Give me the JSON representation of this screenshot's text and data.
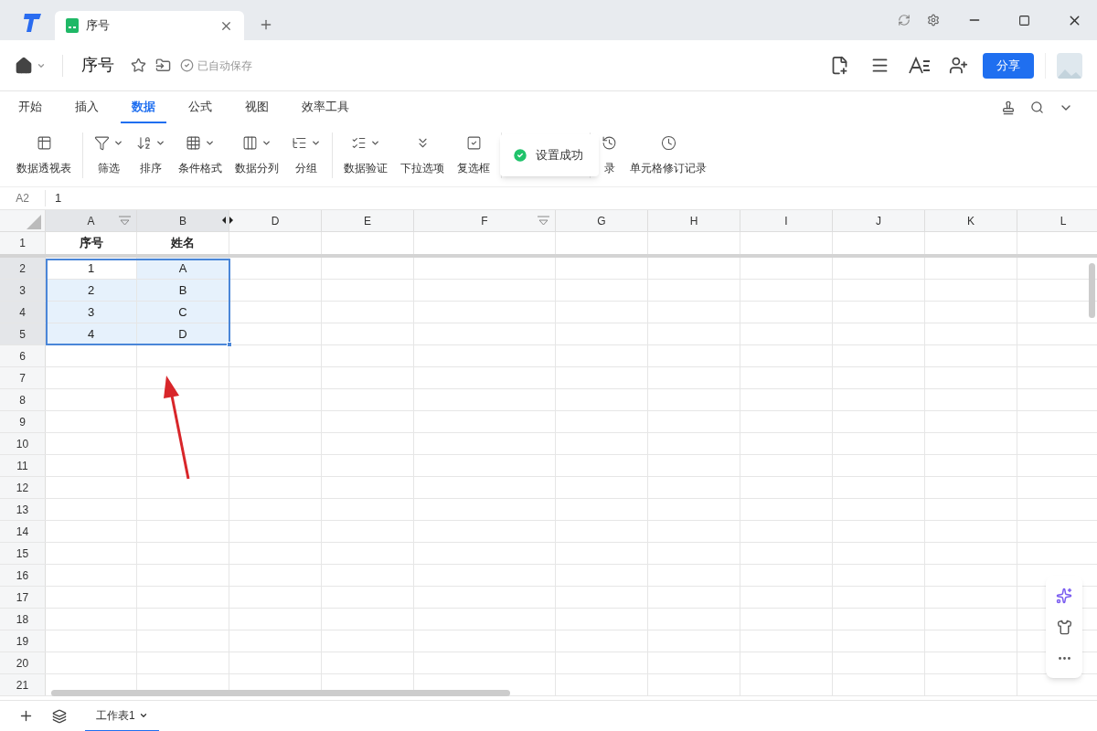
{
  "window": {
    "tab_title": "序号"
  },
  "header": {
    "doc_title": "序号",
    "save_status": "已自动保存",
    "share": "分享"
  },
  "ribbon_tabs": [
    {
      "label": "开始",
      "selected": false
    },
    {
      "label": "插入",
      "selected": false
    },
    {
      "label": "数据",
      "selected": true
    },
    {
      "label": "公式",
      "selected": false
    },
    {
      "label": "视图",
      "selected": false
    },
    {
      "label": "效率工具",
      "selected": false
    }
  ],
  "toolbar_groups": [
    [
      {
        "kind": "pivot",
        "label": "数据透视表",
        "menu": false
      }
    ],
    [
      {
        "kind": "filter",
        "label": "筛选",
        "menu": true
      },
      {
        "kind": "sort",
        "label": "排序",
        "menu": true
      },
      {
        "kind": "format",
        "label": "条件格式",
        "menu": true
      },
      {
        "kind": "split",
        "label": "数据分列",
        "menu": true
      },
      {
        "kind": "group",
        "label": "分组",
        "menu": true
      }
    ],
    [
      {
        "kind": "validate",
        "label": "数据验证",
        "menu": true
      },
      {
        "kind": "dropdown",
        "label": "下拉选项",
        "menu": false
      },
      {
        "kind": "checkbox",
        "label": "复选框",
        "menu": false
      }
    ],
    [
      {
        "kind": "hidden"
      }
    ],
    [
      {
        "kind": "history",
        "label": "录",
        "menu": false
      },
      {
        "kind": "revision",
        "label": "单元格修订记录",
        "menu": false
      }
    ]
  ],
  "toast": {
    "text": "设置成功"
  },
  "formula_bar": {
    "cell_ref": "A2",
    "value": "1"
  },
  "columns": [
    {
      "letter": "A",
      "filter": true,
      "selected": true
    },
    {
      "letter": "B",
      "filter": false,
      "selected": true
    },
    {
      "letter": "D",
      "filter": false,
      "selected": false
    },
    {
      "letter": "E",
      "filter": false,
      "selected": false
    },
    {
      "letter": "F",
      "filter": true,
      "selected": false
    },
    {
      "letter": "G",
      "filter": false,
      "selected": false
    },
    {
      "letter": "H",
      "filter": false,
      "selected": false
    },
    {
      "letter": "I",
      "filter": false,
      "selected": false
    },
    {
      "letter": "J",
      "filter": false,
      "selected": false
    },
    {
      "letter": "K",
      "filter": false,
      "selected": false
    },
    {
      "letter": "L",
      "filter": false,
      "selected": false
    }
  ],
  "rows": [
    {
      "number": "1",
      "cells": [
        "序号",
        "姓名"
      ],
      "selected": false,
      "header": true
    },
    {
      "number": "2",
      "cells": [
        "1",
        "A"
      ],
      "selected": true,
      "active": true
    },
    {
      "number": "3",
      "cells": [
        "2",
        "B"
      ],
      "selected": true
    },
    {
      "number": "4",
      "cells": [
        "3",
        "C"
      ],
      "selected": true
    },
    {
      "number": "5",
      "cells": [
        "4",
        "D"
      ],
      "selected": true
    },
    {
      "number": "6",
      "selected": false
    },
    {
      "number": "7",
      "selected": false
    },
    {
      "number": "8",
      "selected": false
    },
    {
      "number": "9",
      "selected": false
    },
    {
      "number": "10",
      "selected": false
    },
    {
      "number": "11",
      "selected": false
    },
    {
      "number": "12",
      "selected": false
    },
    {
      "number": "13",
      "selected": false
    },
    {
      "number": "14",
      "selected": false
    },
    {
      "number": "15",
      "selected": false
    },
    {
      "number": "16",
      "selected": false
    },
    {
      "number": "17",
      "selected": false
    },
    {
      "number": "18",
      "selected": false
    },
    {
      "number": "19",
      "selected": false
    },
    {
      "number": "20",
      "selected": false
    },
    {
      "number": "21",
      "selected": false
    }
  ],
  "sheets": [
    {
      "name": "工作表1",
      "selected": true
    }
  ]
}
